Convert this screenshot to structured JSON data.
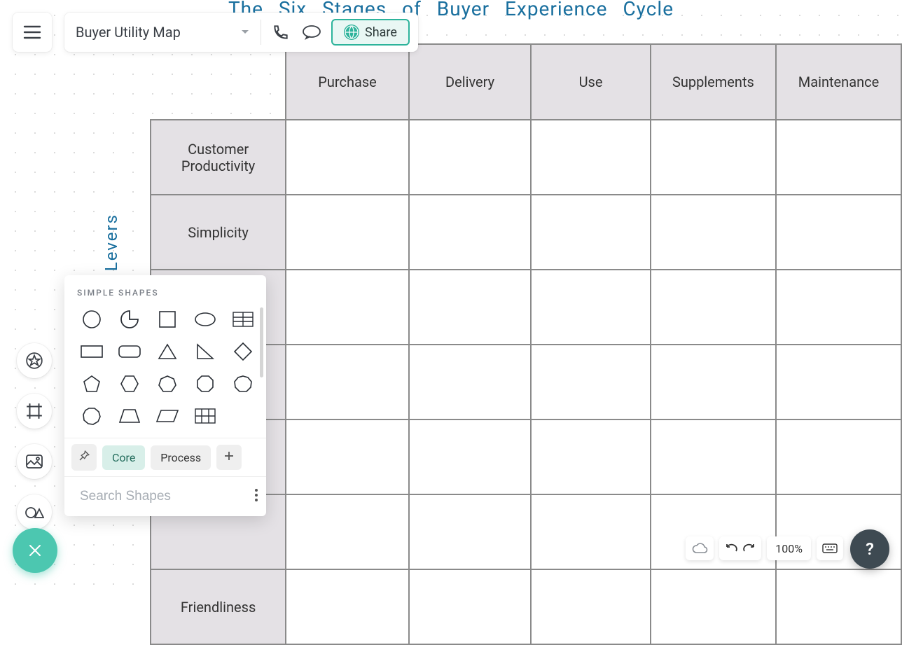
{
  "doc": {
    "title": "Buyer Utility Map"
  },
  "toolbar": {
    "share_label": "Share"
  },
  "canvas": {
    "top_title": "The Six Stages of Buyer Experience Cycle",
    "side_title": "Levers",
    "columns": [
      "Purchase",
      "Delivery",
      "Use",
      "Supplements",
      "Maintenance"
    ],
    "rows": [
      "Customer Productivity",
      "Simplicity",
      "",
      "",
      "",
      "",
      "Friendliness"
    ]
  },
  "shapes_panel": {
    "header": "SIMPLE SHAPES",
    "shapes": [
      "circle",
      "pie",
      "square",
      "ellipse",
      "table-shape",
      "rectangle",
      "rounded-rectangle",
      "triangle",
      "right-triangle",
      "diamond",
      "pentagon",
      "hexagon",
      "heptagon",
      "octagon",
      "nonagon",
      "decagon",
      "trapezoid",
      "parallelogram",
      "grid-shape"
    ],
    "tabs": {
      "pin": "📌",
      "core": "Core",
      "process": "Process",
      "add": "+"
    },
    "search_placeholder": "Search Shapes"
  },
  "bottom": {
    "zoom": "100%"
  },
  "help": {
    "label": "?"
  }
}
